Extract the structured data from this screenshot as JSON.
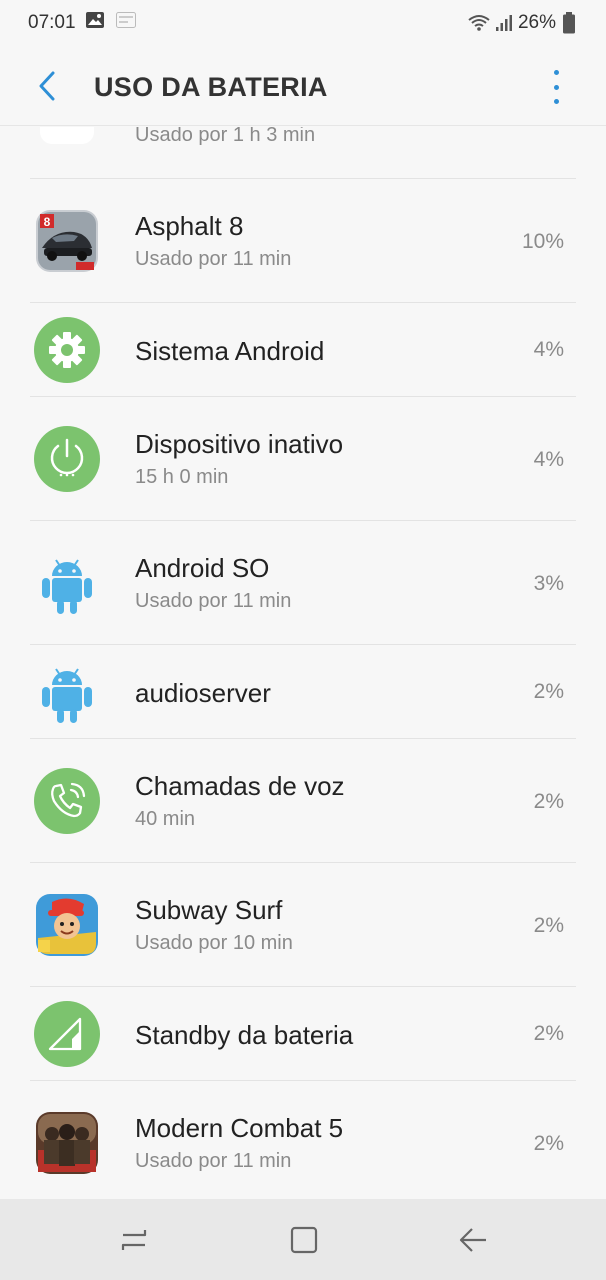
{
  "status": {
    "time": "07:01",
    "battery": "26%"
  },
  "header": {
    "title": "USO DA BATERIA"
  },
  "colors": {
    "accent": "#2e8fd6",
    "green": "#7cc36e",
    "android_blue": "#4fb1e6"
  },
  "partial_item": {
    "subtitle": "Usado por 1 h 3 min"
  },
  "items": [
    {
      "name": "Asphalt 8",
      "subtitle": "Usado por 11 min",
      "percent": "10%",
      "icon": "asphalt-8-icon"
    },
    {
      "name": "Sistema Android",
      "percent": "4%",
      "icon": "gear-icon"
    },
    {
      "name": "Dispositivo inativo",
      "subtitle": "15 h 0 min",
      "percent": "4%",
      "icon": "power-icon"
    },
    {
      "name": "Android SO",
      "subtitle": "Usado por 11 min",
      "percent": "3%",
      "icon": "android-icon"
    },
    {
      "name": "audioserver",
      "percent": "2%",
      "icon": "android-icon"
    },
    {
      "name": "Chamadas de voz",
      "subtitle": "40 min",
      "percent": "2%",
      "icon": "phone-icon"
    },
    {
      "name": "Subway Surf",
      "subtitle": "Usado por 10 min",
      "percent": "2%",
      "icon": "subway-surf-icon"
    },
    {
      "name": "Standby da bateria",
      "percent": "2%",
      "icon": "signal-icon"
    },
    {
      "name": "Modern Combat 5",
      "subtitle": "Usado por 11 min",
      "percent": "2%",
      "icon": "modern-combat-icon"
    }
  ]
}
